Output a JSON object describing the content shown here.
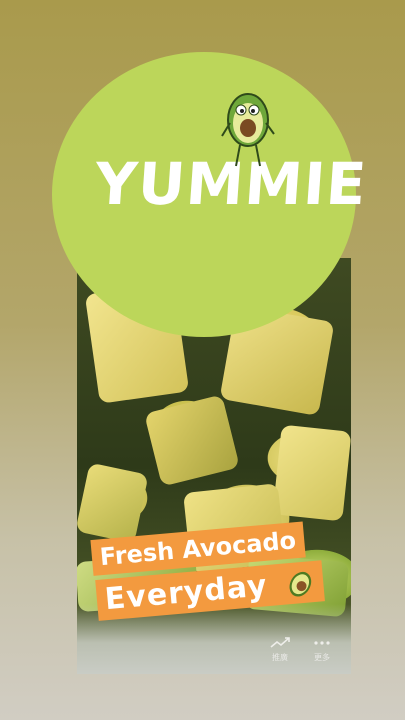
{
  "sticker": {
    "text": "YUMMIE",
    "bubble_color": "#bcd65a",
    "mascot_icon": "avocado-mascot-icon"
  },
  "captions": {
    "line1": "Fresh Avocado",
    "line2": "Everyday",
    "emoji_icon": "avocado-emoji-icon",
    "background_color": "#f39a3f"
  },
  "bottom_bar": {
    "insights_label": "推廣",
    "insights_icon": "trend-up-icon",
    "more_label": "更多",
    "more_icon": "more-dots-icon"
  }
}
